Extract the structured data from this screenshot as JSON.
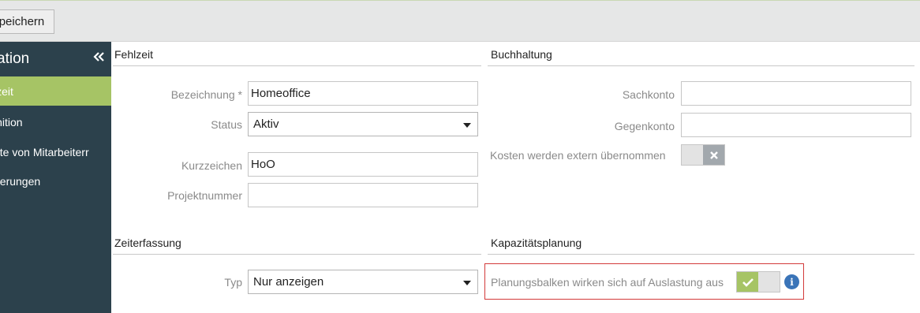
{
  "toolbar": {
    "save_label": "peichern"
  },
  "sidebar": {
    "title": "ation",
    "collapse_icon": "double-chevron-left-icon",
    "items": [
      {
        "label": "lzeit",
        "active": true
      },
      {
        "label": "inition",
        "active": false
      },
      {
        "label": "hte von Mitarbeiterr",
        "active": false
      },
      {
        "label": "derungen",
        "active": false
      }
    ]
  },
  "fehlzeit": {
    "title": "Fehlzeit",
    "bezeichnung_label": "Bezeichnung *",
    "bezeichnung_value": "Homeoffice",
    "status_label": "Status",
    "status_value": "Aktiv",
    "kurzzeichen_label": "Kurzzeichen",
    "kurzzeichen_value": "HoO",
    "projektnummer_label": "Projektnummer",
    "projektnummer_value": ""
  },
  "buchhaltung": {
    "title": "Buchhaltung",
    "sachkonto_label": "Sachkonto",
    "sachkonto_value": "",
    "gegenkonto_label": "Gegenkonto",
    "gegenkonto_value": "",
    "kosten_label": "Kosten werden extern übernommen",
    "kosten_toggle_icon": "x-icon",
    "kosten_enabled": false
  },
  "zeiterfassung": {
    "title": "Zeiterfassung",
    "typ_label": "Typ",
    "typ_value": "Nur anzeigen"
  },
  "kapazitaet": {
    "title": "Kapazitätsplanung",
    "planung_label": "Planungsbalken wirken sich auf Auslastung aus",
    "planung_toggle_icon": "check-icon",
    "planung_enabled": true,
    "info_icon": "info-icon",
    "highlight_color": "#d33a3a"
  },
  "colors": {
    "sidebar_bg": "#2c414c",
    "active_green": "#a6c465",
    "info_blue": "#3a74b8"
  }
}
